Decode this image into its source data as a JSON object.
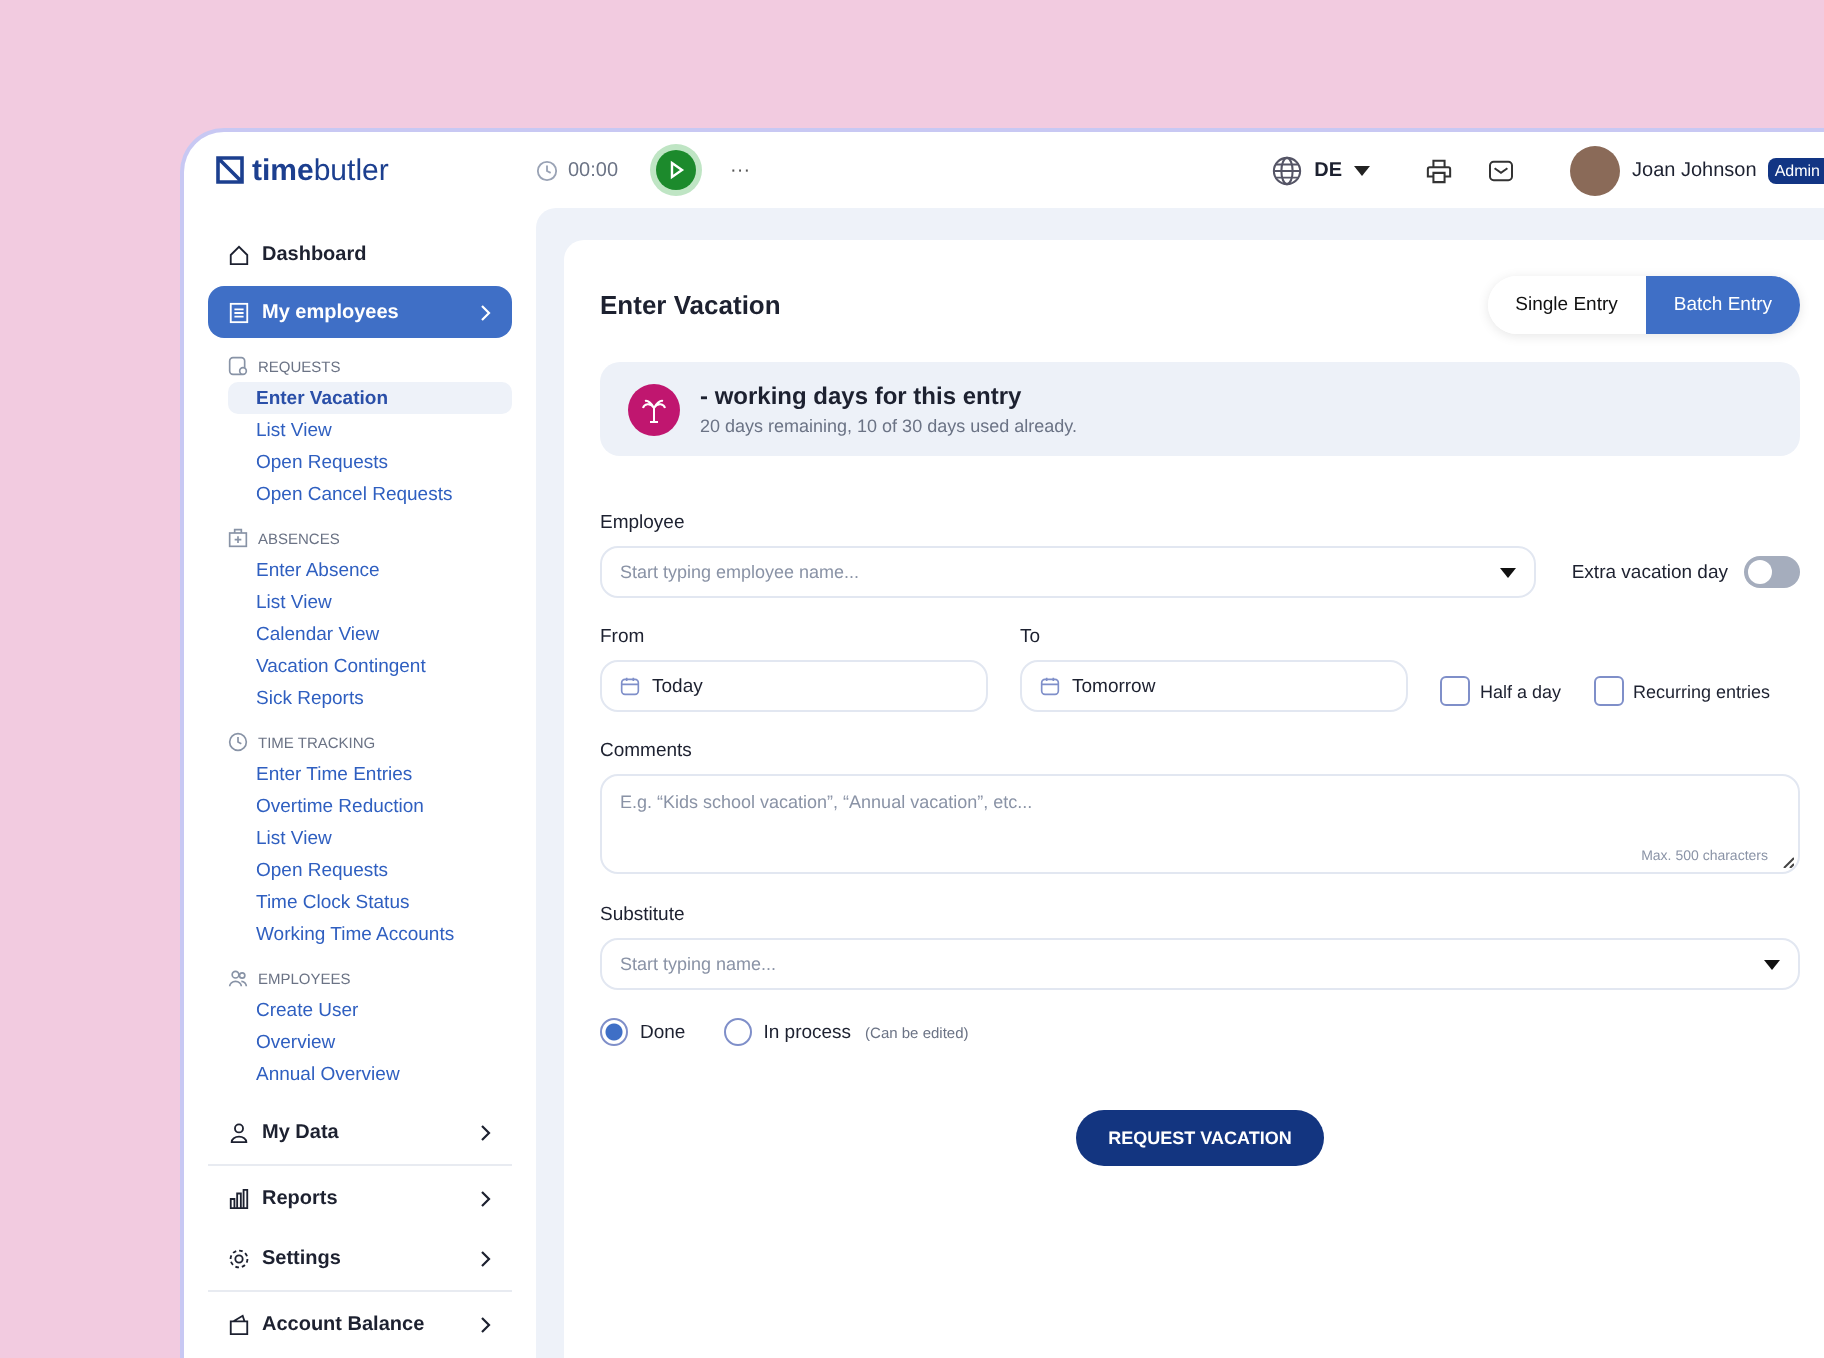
{
  "brand": {
    "logo": "**time**butler"
  },
  "topbar": {
    "timer": "00:00",
    "playing": false,
    "more": "···",
    "language": "DE",
    "user": {
      "name": "Joan Johnson",
      "role": "Admin"
    }
  },
  "sidebar": {
    "items": [
      {
        "label": "Dashboard",
        "kind": "plain",
        "selected": false,
        "separated": false
      },
      {
        "label": "My employees",
        "kind": "group",
        "selected": true,
        "separated": false,
        "sections": [
          {
            "title": "REQUESTS",
            "links": [
              {
                "label": "Enter Vacation",
                "selected": true
              },
              {
                "label": "List View",
                "selected": false
              },
              {
                "label": "Open Requests",
                "selected": false
              },
              {
                "label": "Open Cancel Requests",
                "selected": false
              }
            ]
          },
          {
            "title": "ABSENCES",
            "links": [
              {
                "label": "Enter Absence",
                "selected": false
              },
              {
                "label": "List View",
                "selected": false
              },
              {
                "label": "Calendar View",
                "selected": false
              },
              {
                "label": "Vacation Contingent",
                "selected": false
              },
              {
                "label": "Sick Reports",
                "selected": false
              }
            ]
          },
          {
            "title": "TIME TRACKING",
            "links": [
              {
                "label": "Enter Time Entries",
                "selected": false
              },
              {
                "label": "Overtime Reduction",
                "selected": false
              },
              {
                "label": "List View",
                "selected": false
              },
              {
                "label": "Open Requests",
                "selected": false
              },
              {
                "label": "Time Clock Status",
                "selected": false
              },
              {
                "label": "Working Time Accounts",
                "selected": false
              }
            ]
          },
          {
            "title": "EMPLOYEES",
            "links": [
              {
                "label": "Create User",
                "selected": false
              },
              {
                "label": "Overview",
                "selected": false
              },
              {
                "label": "Annual Overview",
                "selected": false
              }
            ]
          }
        ]
      },
      {
        "label": "My Data",
        "kind": "group",
        "selected": false,
        "separated": false
      },
      {
        "label": "Reports",
        "kind": "group",
        "selected": false,
        "separated": true
      },
      {
        "label": "Settings",
        "kind": "group",
        "selected": false,
        "separated": false
      },
      {
        "label": "Account Balance",
        "kind": "group",
        "selected": false,
        "separated": true
      }
    ]
  },
  "main": {
    "title": "Enter Vacation",
    "modes": [
      {
        "label": "Single Entry",
        "selected": false
      },
      {
        "label": "Batch Entry",
        "selected": true
      }
    ],
    "summary": {
      "headline": "- working days for this entry",
      "detail": "20 days remaining, 10 of 30 days used already."
    },
    "employee": {
      "label": "Employee",
      "placeholder": "Start typing employee name..."
    },
    "extra_vacation_day": {
      "label": "Extra vacation day",
      "on": false
    },
    "from": {
      "label": "From",
      "value": "Today"
    },
    "to": {
      "label": "To",
      "value": "Tomorrow"
    },
    "options": [
      {
        "label": "Half a day",
        "checked": false
      },
      {
        "label": "Recurring entries",
        "checked": false
      }
    ],
    "comments": {
      "label": "Comments",
      "placeholder": "E.g. “Kids school vacation”, “Annual vacation”, etc...",
      "hint": "Max. 500 characters"
    },
    "substitute": {
      "label": "Substitute",
      "placeholder": "Start typing name..."
    },
    "status": [
      {
        "label": "Done",
        "selected": true
      },
      {
        "label": "In process",
        "note": "(Can be edited)",
        "selected": false
      }
    ],
    "submit": "REQUEST VACATION"
  }
}
